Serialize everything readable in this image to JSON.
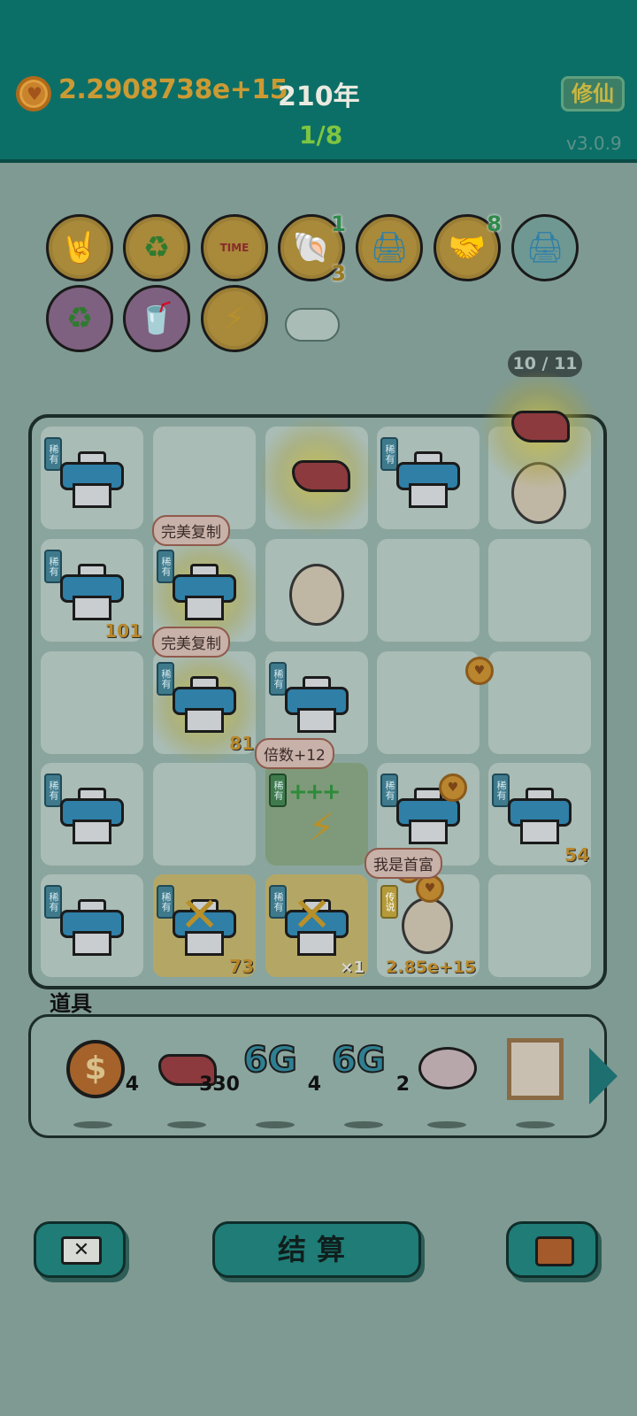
{
  "header": {
    "money": "2.2908738e+15",
    "years": "210年",
    "stage": "1/8",
    "xiuxian_label": "修仙",
    "version": "v3.0.9"
  },
  "badges": {
    "shell_count_top": "1",
    "shell_count_bottom": "3",
    "handshake_count": "8",
    "time_label": "TIME"
  },
  "board": {
    "capacity": "10 / 11",
    "tag_rare": "稀有",
    "tag_legend": "传说",
    "bubble_copy": "完美复制",
    "bubble_multiplier": "倍数+12",
    "bubble_richest": "我是首富",
    "count_101": "101",
    "count_81": "81",
    "count_54": "54",
    "count_73": "73",
    "count_x1": "×1",
    "count_big": "2.85e+15"
  },
  "props": {
    "label": "道具",
    "dollar_count": "4",
    "liver_count": "330",
    "g6a_count": "4",
    "g6b_count": "2",
    "g6_text": "6G"
  },
  "buttons": {
    "settle": "结算"
  }
}
